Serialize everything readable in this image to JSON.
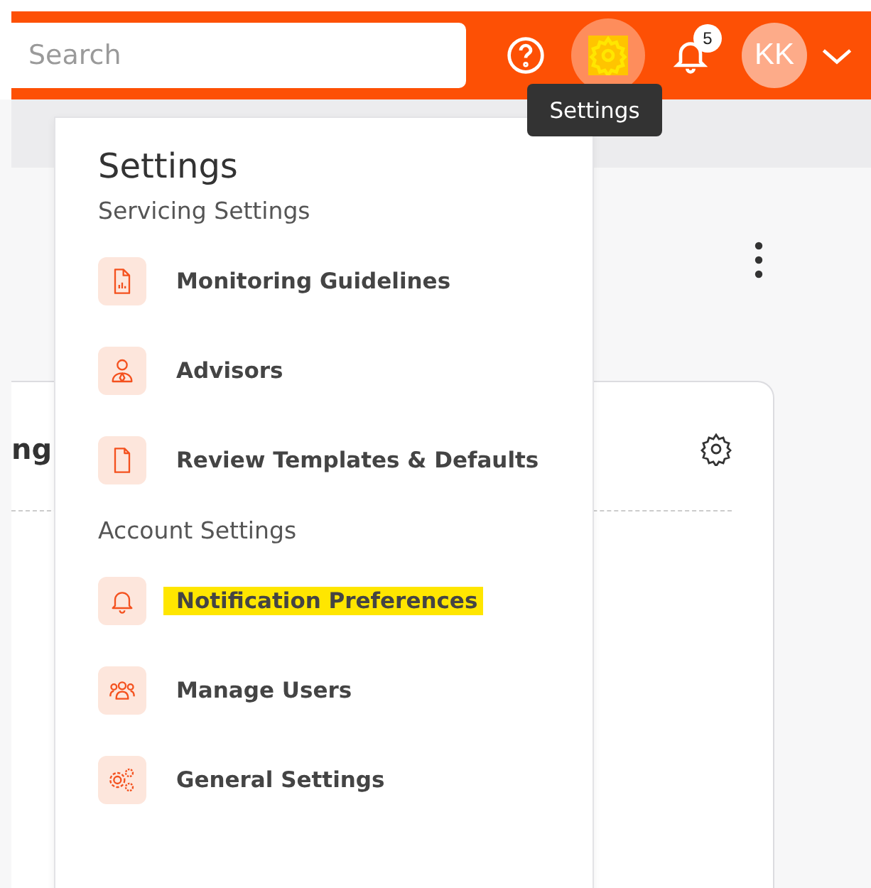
{
  "header": {
    "search": {
      "placeholder": "Search"
    },
    "icons": [
      {
        "kind": "help",
        "highlighted": false
      },
      {
        "kind": "settings",
        "highlighted": true
      },
      {
        "kind": "bell",
        "badge": "5",
        "highlighted": false
      },
      {
        "kind": "avatar",
        "initials": "KK",
        "highlighted": false
      },
      {
        "kind": "chevron",
        "highlighted": false
      }
    ],
    "tooltip": "Settings"
  },
  "card": {
    "title": "ng"
  },
  "menu": {
    "title": "Settings",
    "sections": [
      {
        "label": "Servicing Settings",
        "items": [
          {
            "kind": "report",
            "label": "Monitoring Guidelines",
            "highlighted": false
          },
          {
            "kind": "advisor",
            "label": "Advisors",
            "highlighted": false
          },
          {
            "kind": "document",
            "label": "Review Templates & Defaults",
            "highlighted": false
          }
        ]
      },
      {
        "label": "Account Settings",
        "items": [
          {
            "kind": "bell",
            "label": "Notification Preferences",
            "highlighted": true
          },
          {
            "kind": "users",
            "label": "Manage Users",
            "highlighted": false
          },
          {
            "kind": "gears",
            "label": "General Settings",
            "highlighted": false
          }
        ]
      }
    ]
  }
}
